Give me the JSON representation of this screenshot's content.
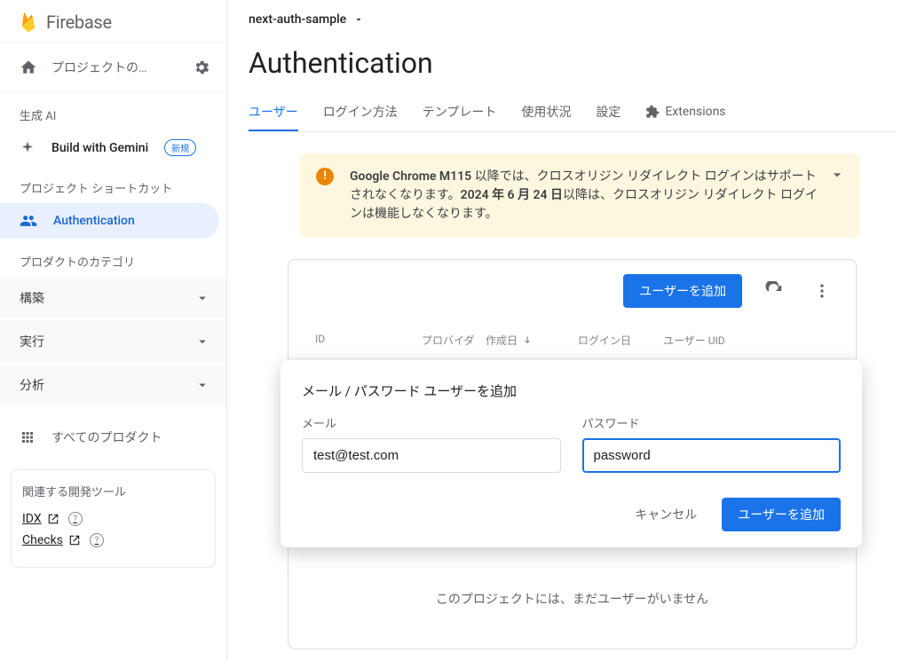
{
  "brand": "Firebase",
  "sidebar": {
    "project_overview": "プロジェクトの…",
    "section_ai": "生成 AI",
    "gemini": {
      "label": "Build with Gemini",
      "badge": "新規"
    },
    "section_shortcuts": "プロジェクト ショートカット",
    "authentication": "Authentication",
    "section_categories": "プロダクトのカテゴリ",
    "categories": {
      "build": "構築",
      "run": "実行",
      "analyze": "分析"
    },
    "all_products": "すべてのプロダクト",
    "tools": {
      "title": "関連する開発ツール",
      "idx": "IDX",
      "checks": "Checks"
    }
  },
  "header": {
    "project_selector": "next-auth-sample",
    "page_title": "Authentication",
    "tabs": {
      "users": "ユーザー",
      "signin": "ログイン方法",
      "templates": "テンプレート",
      "usage": "使用状況",
      "settings": "設定",
      "extensions": "Extensions"
    }
  },
  "warning": {
    "bold1": "Google Chrome M115",
    "part1": " 以降では、クロスオリジン リダイレクト ログインはサポートされなくなります。",
    "bold2": "2024 年 6 月 24 日",
    "part2": "以降は、クロスオリジン リダイレクト ログインは機能しなくなります。"
  },
  "card": {
    "add_user_btn": "ユーザーを追加",
    "columns": {
      "id": "ID",
      "provider": "プロバイダ",
      "created": "作成日",
      "login": "ログイン日",
      "uid": "ユーザー UID"
    },
    "empty": "このプロジェクトには、まだユーザーがいません"
  },
  "dialog": {
    "title": "メール / パスワード ユーザーを追加",
    "email_label": "メール",
    "email_value": "test@test.com",
    "password_label": "パスワード",
    "password_value": "password",
    "cancel": "キャンセル",
    "submit": "ユーザーを追加"
  }
}
